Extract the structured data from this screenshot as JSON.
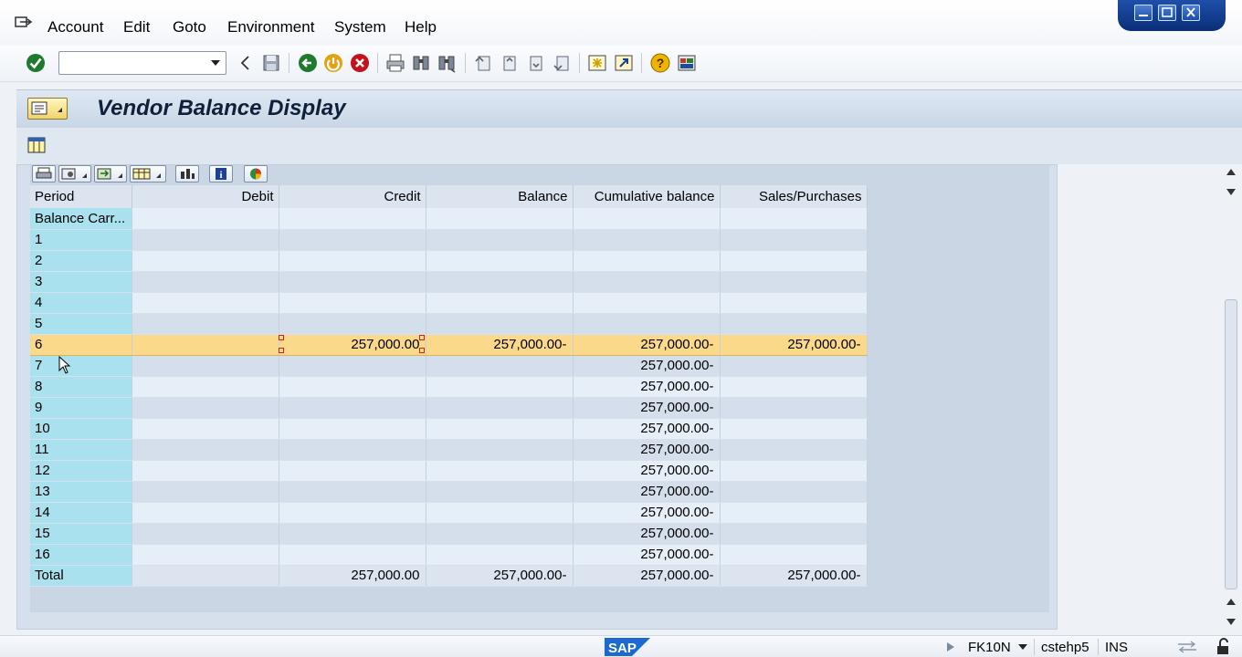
{
  "menubar": {
    "items": [
      {
        "label": "Account"
      },
      {
        "label": "Edit"
      },
      {
        "label": "Goto"
      },
      {
        "label": "Environment"
      },
      {
        "label": "System"
      },
      {
        "label": "Help"
      }
    ]
  },
  "toolbar": {
    "command_field_value": "",
    "icons": [
      "enter-checkmark-icon",
      "back-icon",
      "save-icon",
      "back-nav-icon",
      "exit-icon",
      "cancel-icon",
      "print-icon",
      "find-icon",
      "find-next-icon",
      "first-page-icon",
      "previous-page-icon",
      "next-page-icon",
      "last-page-icon",
      "create-session-icon",
      "shortcut-icon",
      "help-icon",
      "customize-layout-icon"
    ]
  },
  "title": {
    "text": "Vendor Balance Display"
  },
  "grid": {
    "columns": [
      "Period",
      "Debit",
      "Credit",
      "Balance",
      "Cumulative balance",
      "Sales/Purchases"
    ],
    "rows": [
      {
        "period": "Balance Carr...",
        "debit": "",
        "credit": "",
        "balance": "",
        "cumulative": "",
        "sales": ""
      },
      {
        "period": "1",
        "debit": "",
        "credit": "",
        "balance": "",
        "cumulative": "",
        "sales": ""
      },
      {
        "period": "2",
        "debit": "",
        "credit": "",
        "balance": "",
        "cumulative": "",
        "sales": ""
      },
      {
        "period": "3",
        "debit": "",
        "credit": "",
        "balance": "",
        "cumulative": "",
        "sales": ""
      },
      {
        "period": "4",
        "debit": "",
        "credit": "",
        "balance": "",
        "cumulative": "",
        "sales": ""
      },
      {
        "period": "5",
        "debit": "",
        "credit": "",
        "balance": "",
        "cumulative": "",
        "sales": ""
      },
      {
        "period": "6",
        "debit": "",
        "credit": "257,000.00",
        "balance": "257,000.00-",
        "cumulative": "257,000.00-",
        "sales": "257,000.00-",
        "selected": true
      },
      {
        "period": "7",
        "debit": "",
        "credit": "",
        "balance": "",
        "cumulative": "257,000.00-",
        "sales": ""
      },
      {
        "period": "8",
        "debit": "",
        "credit": "",
        "balance": "",
        "cumulative": "257,000.00-",
        "sales": ""
      },
      {
        "period": "9",
        "debit": "",
        "credit": "",
        "balance": "",
        "cumulative": "257,000.00-",
        "sales": ""
      },
      {
        "period": "10",
        "debit": "",
        "credit": "",
        "balance": "",
        "cumulative": "257,000.00-",
        "sales": ""
      },
      {
        "period": "11",
        "debit": "",
        "credit": "",
        "balance": "",
        "cumulative": "257,000.00-",
        "sales": ""
      },
      {
        "period": "12",
        "debit": "",
        "credit": "",
        "balance": "",
        "cumulative": "257,000.00-",
        "sales": ""
      },
      {
        "period": "13",
        "debit": "",
        "credit": "",
        "balance": "",
        "cumulative": "257,000.00-",
        "sales": ""
      },
      {
        "period": "14",
        "debit": "",
        "credit": "",
        "balance": "",
        "cumulative": "257,000.00-",
        "sales": ""
      },
      {
        "period": "15",
        "debit": "",
        "credit": "",
        "balance": "",
        "cumulative": "257,000.00-",
        "sales": ""
      },
      {
        "period": "16",
        "debit": "",
        "credit": "",
        "balance": "",
        "cumulative": "257,000.00-",
        "sales": ""
      },
      {
        "period": "Total",
        "debit": "",
        "credit": "257,000.00",
        "balance": "257,000.00-",
        "cumulative": "257,000.00-",
        "sales": "257,000.00-",
        "total": true
      }
    ]
  },
  "statusbar": {
    "transaction": "FK10N",
    "server": "cstehp5",
    "mode": "INS"
  },
  "colors": {
    "key_column": "#a9e1ee",
    "selected_row": "#fbd98a",
    "title_text": "#10203a"
  }
}
